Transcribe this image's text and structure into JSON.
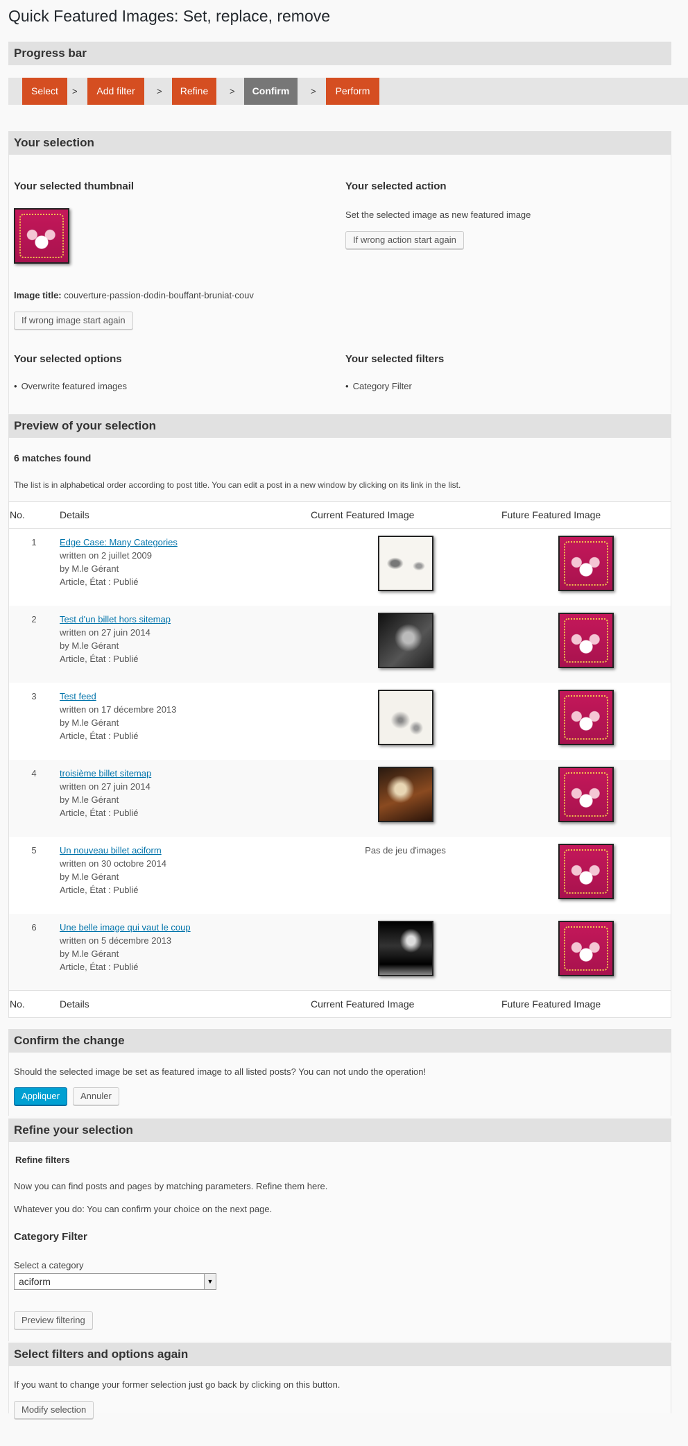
{
  "page_title": "Quick Featured Images: Set, replace, remove",
  "progress": {
    "heading": "Progress bar",
    "steps": [
      "Select",
      "Add filter",
      "Refine",
      "Confirm",
      "Perform"
    ],
    "separator": ">"
  },
  "selection": {
    "heading": "Your selection",
    "thumbnail_heading": "Your selected thumbnail",
    "image_title_label": "Image title:",
    "image_title_value": "couverture-passion-dodin-bouffant-bruniat-couv",
    "wrong_image_button": "If wrong image start again",
    "action_heading": "Your selected action",
    "action_text": "Set the selected image as new featured image",
    "wrong_action_button": "If wrong action start again",
    "options_heading": "Your selected options",
    "options": [
      "Overwrite featured images"
    ],
    "filters_heading": "Your selected filters",
    "filters": [
      "Category Filter"
    ]
  },
  "preview": {
    "heading": "Preview of your selection",
    "matches": "6 matches found",
    "note": "The list is in alphabetical order according to post title. You can edit a post in a new window by clicking on its link in the list.",
    "columns": [
      "No.",
      "Details",
      "Current Featured Image",
      "Future Featured Image"
    ],
    "rows": [
      {
        "no": "1",
        "title": "Edge Case: Many Categories",
        "written": "written on 2 juillet 2009",
        "author": "by M.le Gérant",
        "status": "Article, État : Publié",
        "current": "sketch"
      },
      {
        "no": "2",
        "title": "Test d'un billet hors sitemap",
        "written": "written on 27 juin 2014",
        "author": "by M.le Gérant",
        "status": "Article, État : Publié",
        "current": "dark"
      },
      {
        "no": "3",
        "title": "Test feed",
        "written": "written on 17 décembre 2013",
        "author": "by M.le Gérant",
        "status": "Article, État : Publié",
        "current": "ink"
      },
      {
        "no": "4",
        "title": "troisième billet sitemap",
        "written": "written on 27 juin 2014",
        "author": "by M.le Gérant",
        "status": "Article, État : Publié",
        "current": "painting"
      },
      {
        "no": "5",
        "title": "Un nouveau billet aciform",
        "written": "written on 30 octobre 2014",
        "author": "by M.le Gérant",
        "status": "Article, État : Publié",
        "current": "none",
        "current_text": "Pas de jeu d'images"
      },
      {
        "no": "6",
        "title": "Une belle image qui vaut le coup",
        "written": "written on 5 décembre 2013",
        "author": "by M.le Gérant",
        "status": "Article, État : Publié",
        "current": "bw"
      }
    ]
  },
  "confirm": {
    "heading": "Confirm the change",
    "question": "Should the selected image be set as featured image to all listed posts? You can not undo the operation!",
    "apply_button": "Appliquer",
    "cancel_button": "Annuler"
  },
  "refine": {
    "heading": "Refine your selection",
    "subheading": "Refine filters",
    "text1": "Now you can find posts and pages by matching parameters. Refine them here.",
    "text2": "Whatever you do: You can confirm your choice on the next page.",
    "filter_heading": "Category Filter",
    "select_label": "Select a category",
    "select_value": "aciform",
    "preview_button": "Preview filtering"
  },
  "again": {
    "heading": "Select filters and options again",
    "text": "If you want to change your former selection just go back by clicking on this button.",
    "modify_button": "Modify selection"
  },
  "colors": {
    "step_active": "#d54e21",
    "step_current": "#777777",
    "primary_button": "#00a0d2",
    "link": "#0073aa"
  }
}
